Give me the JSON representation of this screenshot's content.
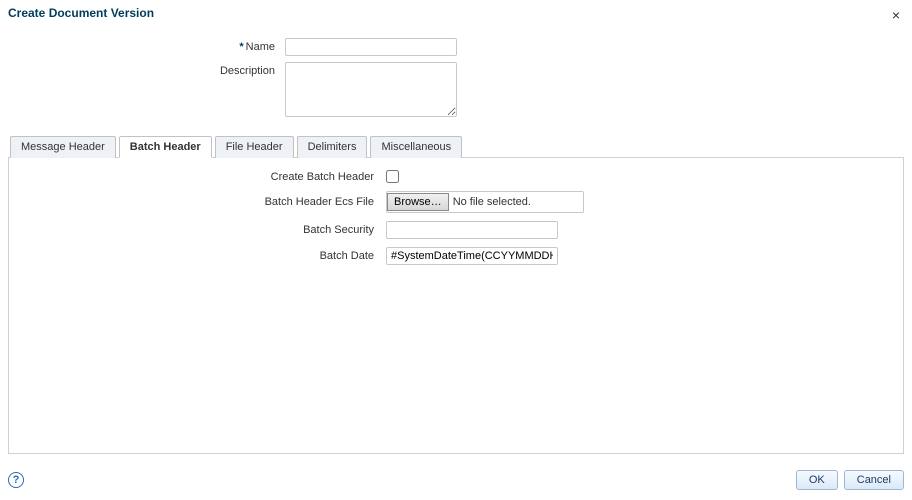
{
  "dialog": {
    "title": "Create Document Version",
    "close_glyph": "×"
  },
  "top_form": {
    "name_label": "Name",
    "name_value": "",
    "name_required_glyph": "*",
    "description_label": "Description",
    "description_value": ""
  },
  "tabs": {
    "message_header": "Message Header",
    "batch_header": "Batch Header",
    "file_header": "File Header",
    "delimiters": "Delimiters",
    "miscellaneous": "Miscellaneous",
    "active": "batch_header"
  },
  "batch_panel": {
    "create_label": "Create Batch Header",
    "ecs_label": "Batch Header Ecs File",
    "browse_label": "Browse…",
    "file_status": "No file selected.",
    "security_label": "Batch Security",
    "security_value": "",
    "date_label": "Batch Date",
    "date_value": "#SystemDateTime(CCYYMMDDHHMM)#"
  },
  "footer": {
    "help_glyph": "?",
    "ok_label": "OK",
    "cancel_label": "Cancel"
  }
}
